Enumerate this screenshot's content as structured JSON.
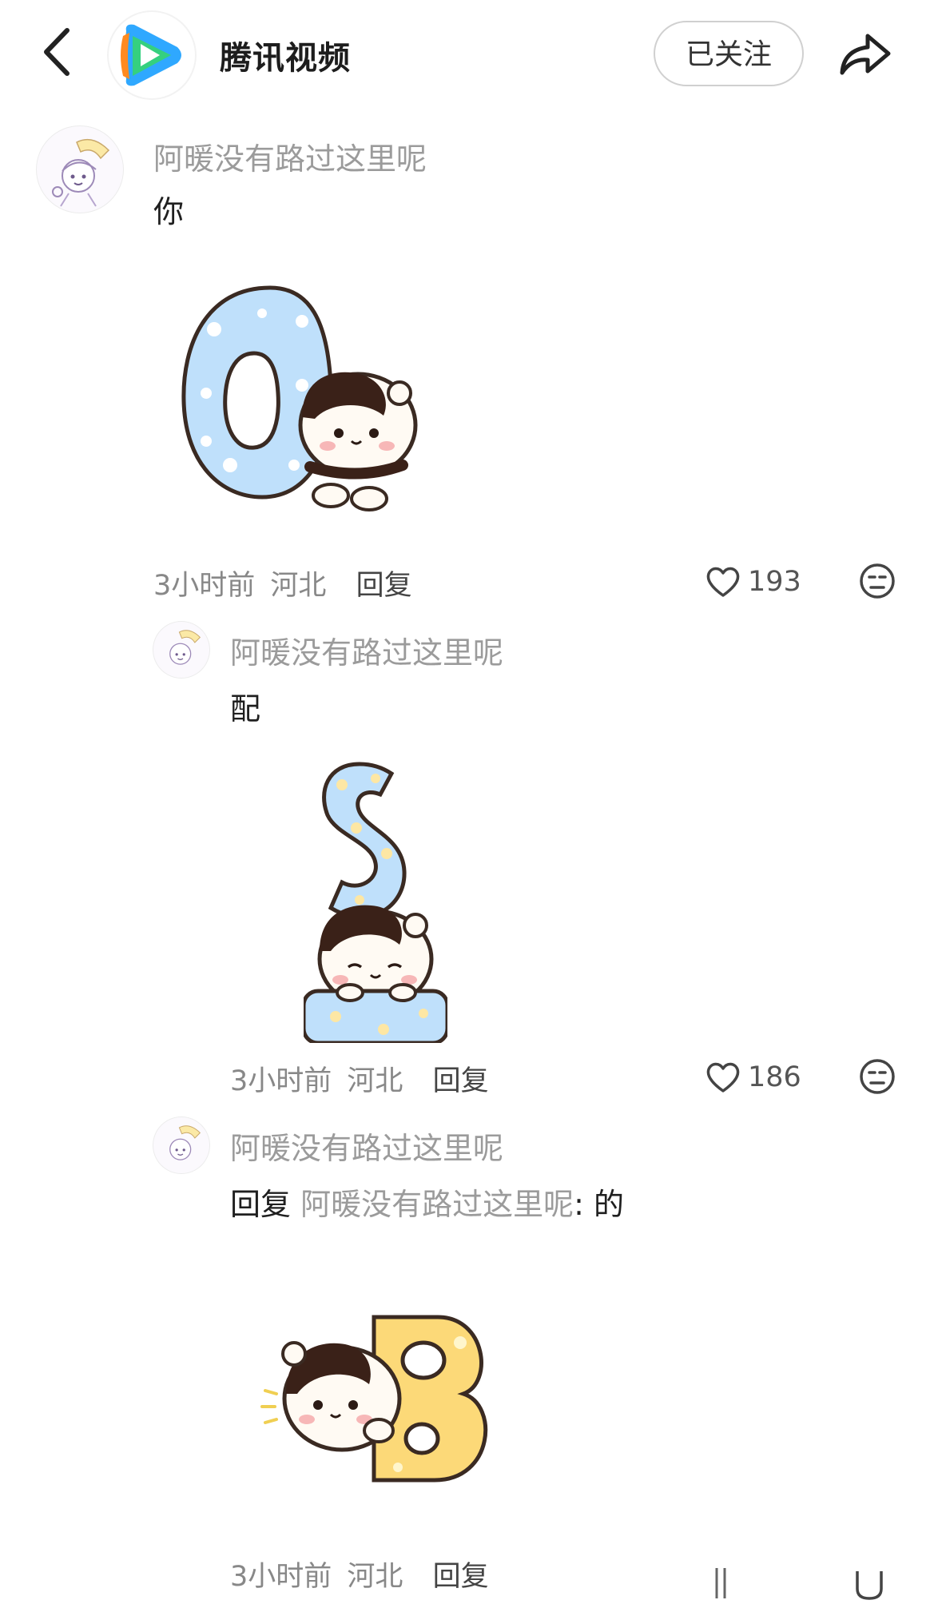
{
  "header": {
    "app_name": "腾讯视频",
    "follow_label": "已关注"
  },
  "comments": [
    {
      "username": "阿暖没有路过这里呢",
      "text": "你",
      "sticker_letter": "O",
      "time": "3小时前",
      "location": "河北",
      "reply_label": "回复",
      "likes": "193"
    },
    {
      "username": "阿暖没有路过这里呢",
      "text": "配",
      "sticker_letter": "S",
      "time": "3小时前",
      "location": "河北",
      "reply_label": "回复",
      "likes": "186"
    },
    {
      "username": "阿暖没有路过这里呢",
      "reply_prefix": "回复",
      "reply_target": "阿暖没有路过这里呢",
      "reply_text": ": 的",
      "sticker_letter": "B",
      "time": "3小时前",
      "location": "河北",
      "reply_label": "回复"
    }
  ],
  "colors": {
    "logo_blue": "#2fa8ff",
    "logo_orange": "#ff8a1f",
    "logo_green": "#35d07f",
    "sticker_blue": "#bfe0fb",
    "sticker_yellow": "#fcd978",
    "cat_dark": "#3a2118"
  }
}
